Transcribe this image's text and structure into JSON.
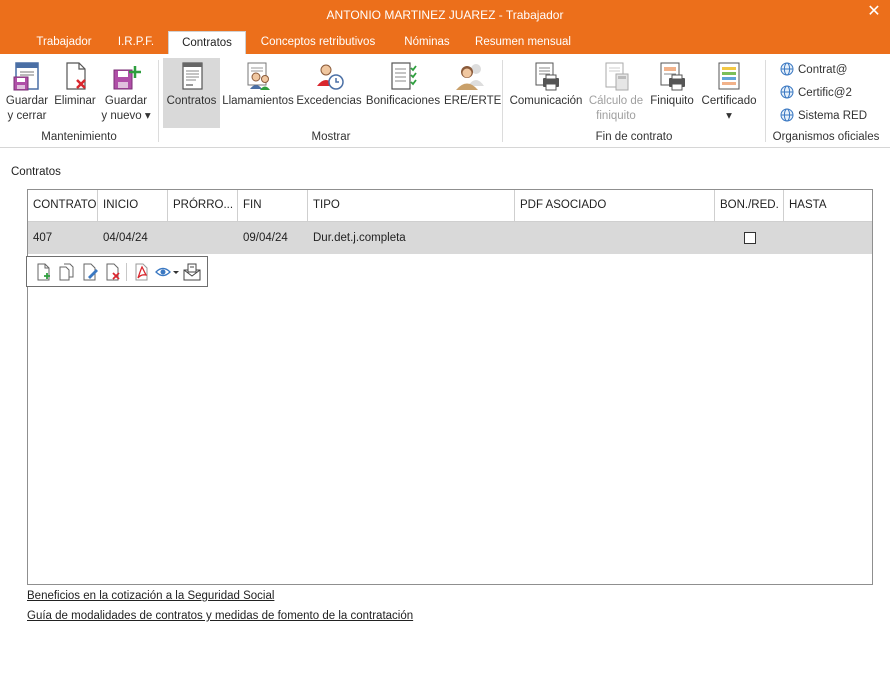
{
  "window": {
    "title": "ANTONIO MARTINEZ JUAREZ - Trabajador",
    "accent": "#ec6f1b"
  },
  "tabs": [
    {
      "label": "Trabajador"
    },
    {
      "label": "I.R.P.F."
    },
    {
      "label": "Contratos"
    },
    {
      "label": "Conceptos retributivos"
    },
    {
      "label": "Nóminas"
    },
    {
      "label": "Resumen mensual"
    }
  ],
  "active_tab": "Contratos",
  "ribbon": {
    "mantenimiento": {
      "label": "Mantenimiento",
      "guardar_cerrar": [
        "Guardar",
        "y cerrar"
      ],
      "eliminar": "Eliminar",
      "guardar_nuevo": [
        "Guardar",
        "y nuevo ▾"
      ]
    },
    "mostrar": {
      "label": "Mostrar",
      "contratos": "Contratos",
      "llamamientos": "Llamamientos",
      "excedencias": "Excedencias",
      "bonificaciones": "Bonificaciones",
      "ere": "ERE/ERTE"
    },
    "fin": {
      "label": "Fin de contrato",
      "comunicacion": "Comunicación",
      "calculo": [
        "Cálculo de",
        "finiquito"
      ],
      "finiquito": "Finiquito",
      "certificado": [
        "Certificado",
        "▾"
      ]
    },
    "organismos": {
      "label": "Organismos oficiales",
      "items": [
        "Contrat@",
        "Certific@2",
        "Sistema RED"
      ]
    }
  },
  "section_title": "Contratos",
  "table": {
    "columns": [
      "CONTRATO",
      "INICIO",
      "PRÓRRO...",
      "FIN",
      "TIPO",
      "PDF ASOCIADO",
      "BON./RED.",
      "HASTA"
    ],
    "rows": [
      {
        "contrato": "407",
        "inicio": "04/04/24",
        "prorroga": "",
        "fin": "09/04/24",
        "tipo": "Dur.det.j.completa",
        "pdf": "",
        "bon_red": false,
        "hasta": ""
      }
    ]
  },
  "row_toolbar_icons": [
    "new-doc-icon",
    "copy-doc-icon",
    "edit-doc-icon",
    "delete-doc-icon",
    "pdf-icon",
    "view-icon",
    "email-icon"
  ],
  "links": {
    "beneficios": "Beneficios en la cotización a la Seguridad Social",
    "guia": "Guía de modalidades de contratos y medidas de fomento de la contratación"
  }
}
